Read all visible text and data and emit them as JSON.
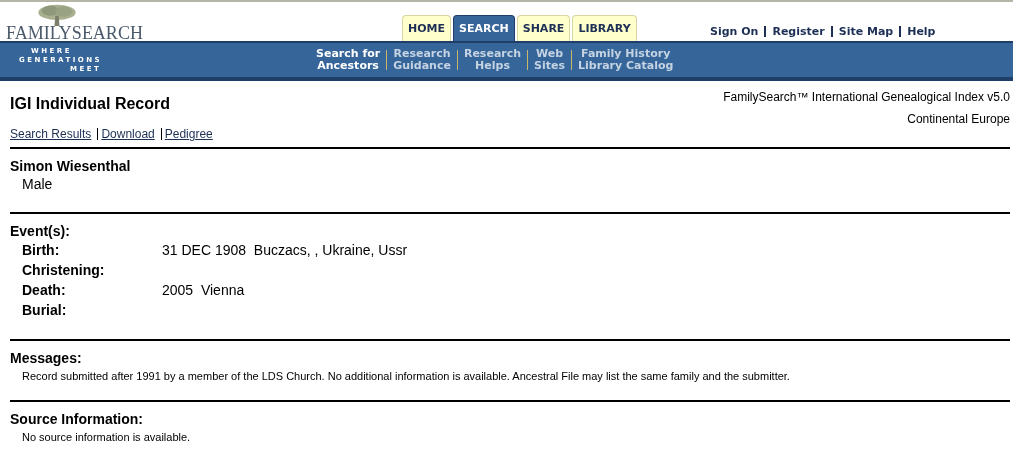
{
  "header": {
    "logo": "FAMILYSEARCH",
    "tagline": [
      "WHERE",
      "GENERATIONS",
      "MEET"
    ],
    "tabs": [
      {
        "label": "HOME",
        "selected": false
      },
      {
        "label": "SEARCH",
        "selected": true
      },
      {
        "label": "SHARE",
        "selected": false
      },
      {
        "label": "LIBRARY",
        "selected": false
      }
    ],
    "account_links": [
      "Sign On",
      "Register",
      "Site Map",
      "Help"
    ],
    "subnav": [
      {
        "lines": [
          "Search for",
          "Ancestors"
        ],
        "selected": true
      },
      {
        "lines": [
          "Research",
          "Guidance"
        ],
        "selected": false
      },
      {
        "lines": [
          "Research",
          "Helps"
        ],
        "selected": false
      },
      {
        "lines": [
          "Web",
          "Sites"
        ],
        "selected": false
      },
      {
        "lines": [
          "Family History",
          "Library Catalog"
        ],
        "selected": false
      }
    ]
  },
  "record": {
    "title": "IGI Individual Record",
    "index_name": "FamilySearch™ International Genealogical Index v5.0",
    "region": "Continental Europe",
    "links": [
      "Search Results",
      "Download",
      "Pedigree"
    ],
    "person": {
      "name": "Simon Wiesenthal",
      "sex": "Male"
    },
    "events_heading": "Event(s):",
    "events": [
      {
        "label": "Birth:",
        "value": "31 DEC 1908  Buczacs, , Ukraine, Ussr"
      },
      {
        "label": "Christening:"
      },
      {
        "label": "Death:",
        "value": "2005  Vienna"
      },
      {
        "label": "Burial:"
      }
    ],
    "messages_heading": "Messages:",
    "message": "Record submitted after 1991 by a member of the LDS Church. No additional information is available. Ancestral File may list the same family and the submitter.",
    "source_heading": "Source Information:",
    "source": "No source information is available."
  }
}
